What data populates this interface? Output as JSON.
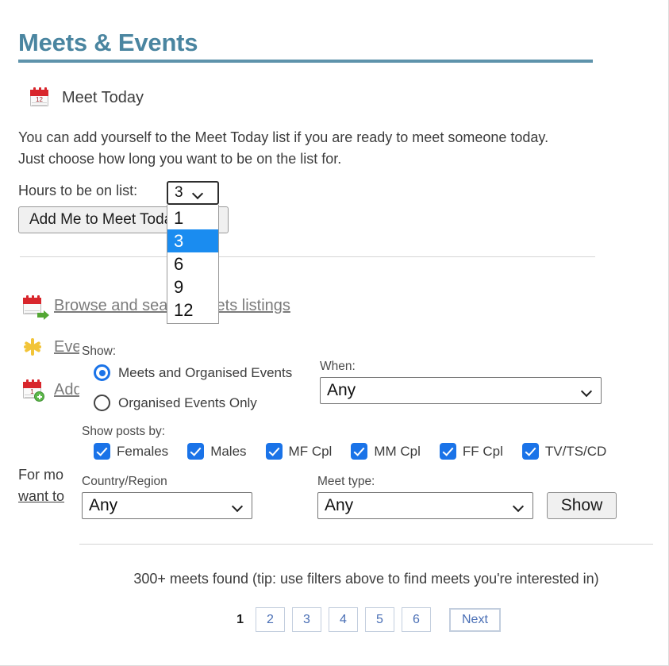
{
  "page": {
    "title": "Meets & Events",
    "accent_color": "#4a85a0"
  },
  "meet_today": {
    "icon": "calendar-icon",
    "heading": "Meet Today",
    "intro": "You can add yourself to the Meet Today list if you are ready to meet someone today. Just choose how long you want to be on the list for.",
    "hours_label": "Hours to be on list:",
    "hours_selected": "3",
    "hours_options": [
      "1",
      "3",
      "6",
      "9",
      "12"
    ],
    "add_button": "Add Me to Meet Today list"
  },
  "links": [
    {
      "icon": "calendar-arrow-icon",
      "label": "Browse and search Meets listings"
    },
    {
      "icon": "star-icon",
      "label": "Events"
    },
    {
      "icon": "calendar-plus-icon",
      "label": "Add"
    }
  ],
  "footer_note": {
    "line1": "For mo",
    "line2": "want to"
  },
  "filters": {
    "show_label": "Show:",
    "radio_options": [
      {
        "label": "Meets and Organised Events",
        "selected": true
      },
      {
        "label": "Organised Events Only",
        "selected": false
      }
    ],
    "when_label": "When:",
    "when_value": "Any",
    "posts_by_label": "Show posts by:",
    "checkboxes": [
      {
        "label": "Females",
        "checked": true
      },
      {
        "label": "Males",
        "checked": true
      },
      {
        "label": "MF Cpl",
        "checked": true
      },
      {
        "label": "MM Cpl",
        "checked": true
      },
      {
        "label": "FF Cpl",
        "checked": true
      },
      {
        "label": "TV/TS/CD",
        "checked": true
      }
    ],
    "country_label": "Country/Region",
    "country_value": "Any",
    "meet_type_label": "Meet type:",
    "meet_type_value": "Any",
    "show_button": "Show"
  },
  "results": {
    "summary": "300+ meets found (tip: use filters above to find meets you're interested in)",
    "current_page": "1",
    "pages": [
      "2",
      "3",
      "4",
      "5",
      "6"
    ],
    "next_label": "Next"
  }
}
